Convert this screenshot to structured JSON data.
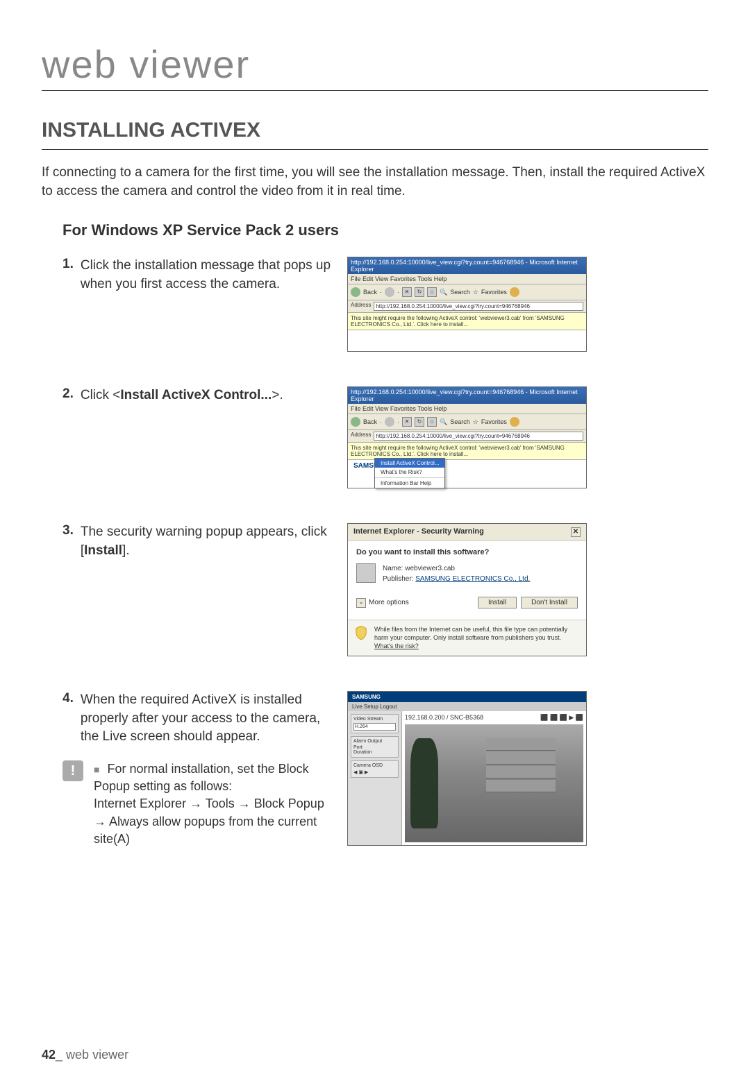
{
  "header": "web viewer",
  "section_title": "INSTALLING ACTIVEX",
  "intro": "If connecting to a camera for the first time, you will see the installation message. Then, install the required ActiveX to access the camera and control the video from it in real time.",
  "sub_heading": "For Windows XP Service Pack 2 users",
  "steps": [
    {
      "num": "1.",
      "text": "Click the installation message that pops up when you first access the camera."
    },
    {
      "num": "2.",
      "text_pre": "Click <",
      "text_bold": "Install ActiveX Control...",
      "text_post": ">."
    },
    {
      "num": "3.",
      "text_pre": "The security warning popup appears, click [",
      "text_bold": "Install",
      "text_post": "]."
    },
    {
      "num": "4.",
      "text": "When the required ActiveX is installed properly after your access to the camera, the Live screen should appear."
    }
  ],
  "note": {
    "line1": "For normal installation, set the Block Popup setting as follows:",
    "line2": "Internet Explorer → Tools → Block Popup → Always allow popups from the current site(A)"
  },
  "footer": {
    "page": "42",
    "label": "_ web viewer"
  },
  "ie": {
    "title": "http://192.168.0.254:10000/live_view.cgi?try.count=946768946 - Microsoft Internet Explorer",
    "menu": "File   Edit   View   Favorites   Tools   Help",
    "toolbar": {
      "back": "Back",
      "search": "Search",
      "favorites": "Favorites"
    },
    "address_label": "Address",
    "address": "http://192.168.0.254:10000/live_view.cgi?try.count=946768946",
    "infobar": "This site might require the following ActiveX control: 'webviewer3.cab' from 'SAMSUNG ELECTRONICS Co., Ltd.'. Click here to install...",
    "context_menu": {
      "install": "Install ActiveX Control...",
      "risk": "What's the Risk?",
      "help": "Information Bar Help"
    },
    "samsung": "SAMSUNG"
  },
  "security_warning": {
    "title": "Internet Explorer - Security Warning",
    "question": "Do you want to install this software?",
    "name_label": "Name:",
    "name": "webviewer3.cab",
    "publisher_label": "Publisher:",
    "publisher": "SAMSUNG ELECTRONICS Co., Ltd.",
    "more": "More options",
    "install": "Install",
    "dont_install": "Don't Install",
    "footer_text": "While files from the Internet can be useful, this file type can potentially harm your computer. Only install software from publishers you trust.",
    "risk": "What's the risk?"
  },
  "live": {
    "brand": "SAMSUNG",
    "tabs": "Live  Setup  Logout",
    "address": "192.168.0.200 / SNC-B5368",
    "sidebar": {
      "section1": "Video Stream",
      "option1": "H.264",
      "section2": "Alarm Output",
      "port": "Port",
      "duration": "Duration",
      "section3": "Camera OSD"
    },
    "icons": "⬛ ⬛ ⬛ ▶ ⬛"
  }
}
